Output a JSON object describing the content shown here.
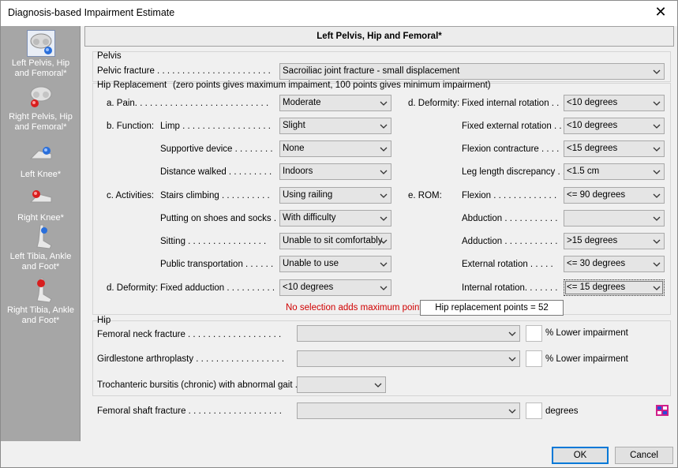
{
  "window": {
    "title": "Diagnosis-based Impairment Estimate"
  },
  "sidebar": {
    "items": [
      {
        "label": "Left Pelvis, Hip and Femoral*",
        "icon": "pelvis-left-icon"
      },
      {
        "label": "Right Pelvis, Hip and Femoral*",
        "icon": "pelvis-right-icon"
      },
      {
        "label": "Left Knee*",
        "icon": "knee-left-icon"
      },
      {
        "label": "Right Knee*",
        "icon": "knee-right-icon"
      },
      {
        "label": "Left Tibia, Ankle and Foot*",
        "icon": "foot-left-icon"
      },
      {
        "label": "Right Tibia, Ankle and Foot*",
        "icon": "foot-right-icon"
      }
    ]
  },
  "header": {
    "title": "Left Pelvis, Hip and Femoral*"
  },
  "pelvis": {
    "group_label": "Pelvis",
    "fracture_label": "Pelvic fracture . . . . . . . . . . . . . . . . . . . . . . .",
    "fracture_value": "Sacroiliac joint fracture - small displacement"
  },
  "hip_replacement": {
    "group_label": "Hip Replacement",
    "note": "(zero points gives maximum impaiment, 100 points gives minimum impairment)",
    "pain_label": "a. Pain. . . . . . . . . . . . . . . . . . . . . . . . . . .",
    "pain_value": "Moderate",
    "function_label": "b. Function:",
    "limp_label": "Limp . . . . . . . . . . . . . . . . . .",
    "limp_value": "Slight",
    "supportive_label": "Supportive device . . . . . . . .",
    "supportive_value": "None",
    "distance_label": "Distance walked . . . . . . . . .",
    "distance_value": "Indoors",
    "activities_label": "c. Activities:",
    "stairs_label": "Stairs climbing . . . . . . . . . .",
    "stairs_value": "Using railing",
    "shoes_label": "Putting on shoes and socks . .",
    "shoes_value": "With difficulty",
    "sitting_label": "Sitting . . . . . . . . . . . . . . . .",
    "sitting_value": "Unable to sit comfortably",
    "transport_label": "Public transportation . . . . . .",
    "transport_value": "Unable to use",
    "deformity_label": "d. Deformity:",
    "fixed_adduction_label": "Fixed adduction . . . . . . . . . .",
    "fixed_adduction_value": "<10 degrees",
    "deformity_right_label": "d. Deformity:",
    "fixed_internal_label": "Fixed internal rotation . .",
    "fixed_internal_value": "<10 degrees",
    "fixed_external_label": "Fixed external rotation . .",
    "fixed_external_value": "<10 degrees",
    "flexion_contracture_label": "Flexion contracture . . . .",
    "flexion_contracture_value": "<15 degrees",
    "leg_length_label": "Leg length discrepancy . .",
    "leg_length_value": "<1.5 cm",
    "rom_label": "e. ROM:",
    "flexion_label": "Flexion . . . . . . . . . . . . .",
    "flexion_value": "<= 90 degrees",
    "abduction_label": "Abduction . . . . . . . . . . .",
    "abduction_value": "",
    "adduction_label": "Adduction . . . . . . . . . . .",
    "adduction_value": ">15 degrees",
    "external_rotation_label": "External rotation . . . . .",
    "external_rotation_value": "<= 30 degrees",
    "internal_rotation_label": "Internal rotation. . . . . . .",
    "internal_rotation_value": "<= 15 degrees",
    "warning": "No selection adds maximum points",
    "points_text": "Hip replacement points = 52"
  },
  "hip": {
    "group_label": "Hip",
    "femoral_neck_label": "Femoral neck fracture . . . . . . . . . . . . . . . . . . .",
    "femoral_neck_value": "",
    "femoral_neck_unit": "% Lower impairment",
    "girdlestone_label": "Girdlestone arthroplasty . . . . . . . . . . . . . . . . . .",
    "girdlestone_value": "",
    "girdlestone_unit": "% Lower impairment",
    "bursitis_label": "Trochanteric bursitis (chronic) with abnormal gait . .",
    "bursitis_value": ""
  },
  "femoral_shaft": {
    "label": "Femoral shaft fracture . . . . . . . . . . . . . . . . . . .",
    "value": "",
    "unit": "degrees"
  },
  "buttons": {
    "ok": "OK",
    "cancel": "Cancel"
  }
}
